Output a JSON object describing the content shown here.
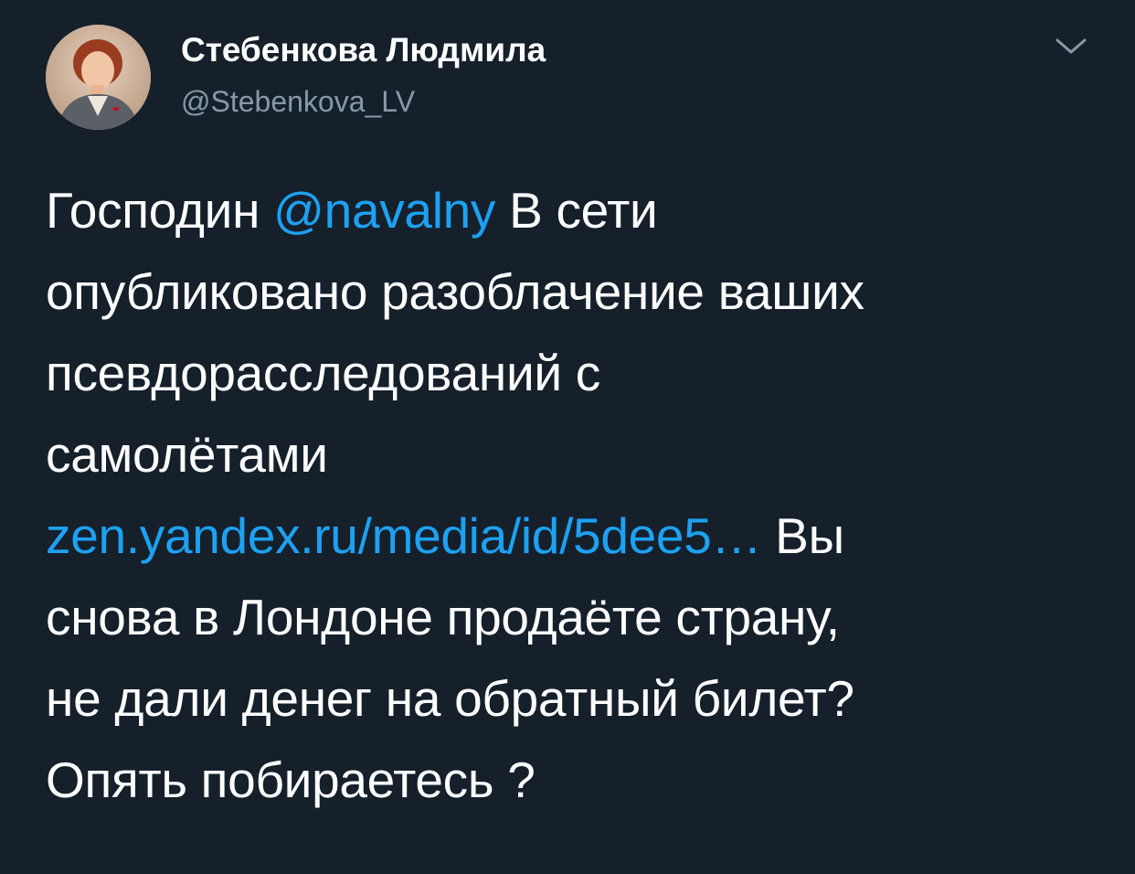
{
  "author": {
    "name": "Стебенкова Людмила",
    "handle": "@Stebenkova_LV",
    "avatar_icon": "profile-photo"
  },
  "menu": {
    "icon": "chevron-down-icon"
  },
  "tweet": {
    "lines": [
      {
        "pre": "Господин ",
        "mention": "@navalny",
        "post": " В сети"
      },
      {
        "text": "опубликовано разоблачение ваших"
      },
      {
        "text": "псевдорасследований с"
      },
      {
        "text": "самолётами"
      },
      {
        "link": "zen.yandex.ru/media/id/5dee5…",
        "post": " Вы"
      },
      {
        "text": "снова в Лондоне продаёте страну,"
      },
      {
        "text": "не дали денег на обратный билет?"
      },
      {
        "text": "Опять побираетесь ?"
      }
    ]
  },
  "colors": {
    "background": "#15202b",
    "text": "#ffffff",
    "secondary_text": "#8899a6",
    "link": "#1da1f2"
  }
}
